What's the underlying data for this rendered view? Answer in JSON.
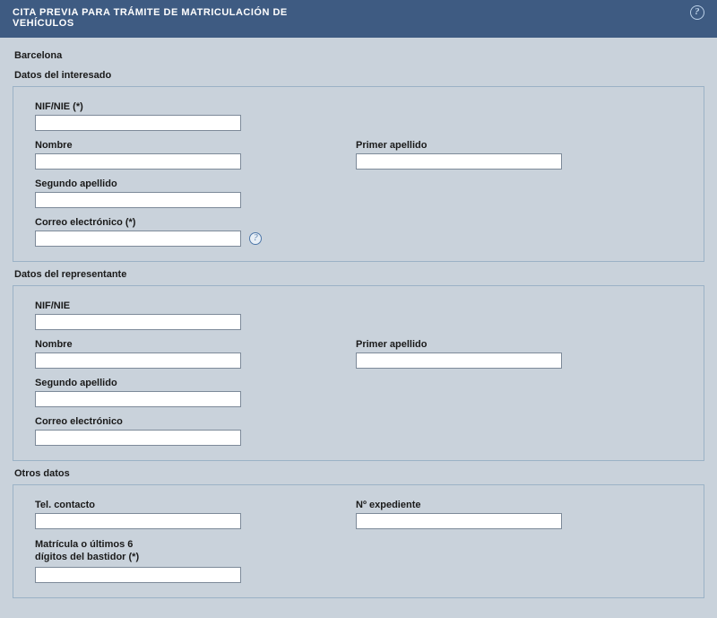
{
  "header": {
    "title_line1": "CITA PREVIA PARA TRÁMITE DE MATRICULACIÓN DE",
    "title_line2": "VEHÍCULOS"
  },
  "location": "Barcelona",
  "sections": {
    "interesado": {
      "title": "Datos del interesado",
      "fields": {
        "nif_label": "NIF/NIE (*)",
        "nif_value": "",
        "nombre_label": "Nombre",
        "nombre_value": "",
        "apellido1_label": "Primer apellido",
        "apellido1_value": "",
        "apellido2_label": "Segundo apellido",
        "apellido2_value": "",
        "correo_label": "Correo electrónico (*)",
        "correo_value": ""
      }
    },
    "representante": {
      "title": "Datos del representante",
      "fields": {
        "nif_label": "NIF/NIE",
        "nif_value": "",
        "nombre_label": "Nombre",
        "nombre_value": "",
        "apellido1_label": "Primer apellido",
        "apellido1_value": "",
        "apellido2_label": "Segundo apellido",
        "apellido2_value": "",
        "correo_label": "Correo electrónico",
        "correo_value": ""
      }
    },
    "otros": {
      "title": "Otros datos",
      "fields": {
        "tel_label": "Tel. contacto",
        "tel_value": "",
        "expediente_label": "Nº expediente",
        "expediente_value": "",
        "matricula_label_l1": "Matrícula o últimos 6",
        "matricula_label_l2": "dígitos del bastidor (*)",
        "matricula_value": ""
      }
    }
  }
}
